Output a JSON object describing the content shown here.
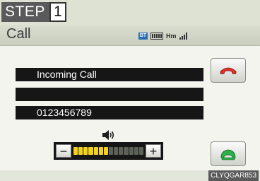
{
  "step": {
    "label": "STEP",
    "number": "1"
  },
  "header": {
    "title": "Call",
    "status": {
      "bt_label": "BT",
      "carrier": "Hm",
      "icons": [
        "bluetooth-icon",
        "battery-icon",
        "signal-icon"
      ]
    }
  },
  "call": {
    "line1": "Incoming Call",
    "line2": "",
    "line3": "0123456789"
  },
  "buttons": {
    "hangup_icon": "phone-hangup-icon",
    "answer_icon": "phone-answer-icon",
    "volume_down": "−",
    "volume_up": "+"
  },
  "volume": {
    "level": 7,
    "max": 14,
    "icon": "speaker-icon"
  },
  "footer": {
    "code": "CLYQGAR853"
  },
  "colors": {
    "hangup": "#e0302a",
    "answer": "#2bb04b",
    "volume_on": "#f2d21f"
  }
}
